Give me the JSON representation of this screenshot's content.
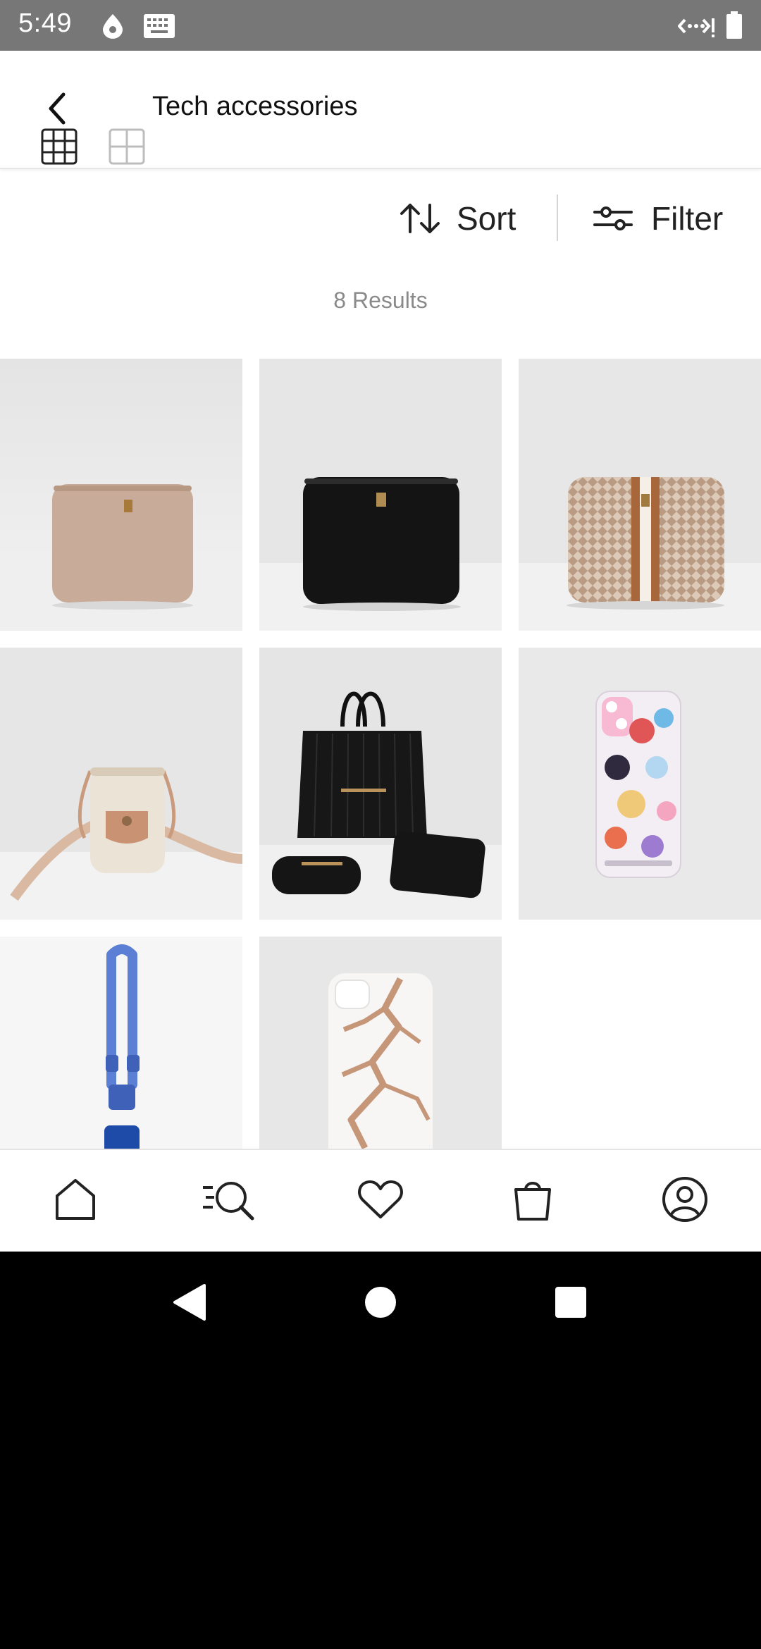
{
  "status_bar": {
    "time": "5:49",
    "icons": [
      "data-saver-icon",
      "keyboard-icon",
      "network-icon",
      "battery-icon"
    ]
  },
  "header": {
    "title": "Tech accessories",
    "back_icon": "back-arrow-icon"
  },
  "toolbar": {
    "view_options": [
      "grid-3-col-icon",
      "grid-2-col-icon"
    ],
    "selected_view": "grid-3-col-icon",
    "sort_label": "Sort",
    "filter_label": "Filter"
  },
  "results": {
    "count_text": "8 Results"
  },
  "products": [
    {
      "name": "laptop-sleeve-taupe",
      "kind": "laptop-sleeve",
      "color": "#c9ad9b"
    },
    {
      "name": "laptop-sleeve-black",
      "kind": "laptop-sleeve",
      "color": "#151515"
    },
    {
      "name": "laptop-sleeve-monogram",
      "kind": "laptop-sleeve",
      "color": "#d8c6b6"
    },
    {
      "name": "phone-crossbody-bag-cream",
      "kind": "crossbody",
      "color": "#e9e1d3"
    },
    {
      "name": "quilted-tote-set-black",
      "kind": "tote",
      "color": "#171717"
    },
    {
      "name": "disney-princess-phone-case",
      "kind": "phone-case",
      "color": "#f2eef2"
    },
    {
      "name": "phone-lanyard-blue",
      "kind": "lanyard",
      "color": "#5b7fd4"
    },
    {
      "name": "marble-phone-case",
      "kind": "phone-case",
      "color": "#f6f5f4"
    }
  ],
  "bottom_nav": {
    "items": [
      "home-icon",
      "search-icon",
      "wishlist-heart-icon",
      "bag-icon",
      "account-icon"
    ]
  },
  "colors": {
    "status_bar": "#777777",
    "background": "#ffffff",
    "text_primary": "#111111",
    "text_muted": "#8a8a8a",
    "divider": "#e6e6e6"
  }
}
